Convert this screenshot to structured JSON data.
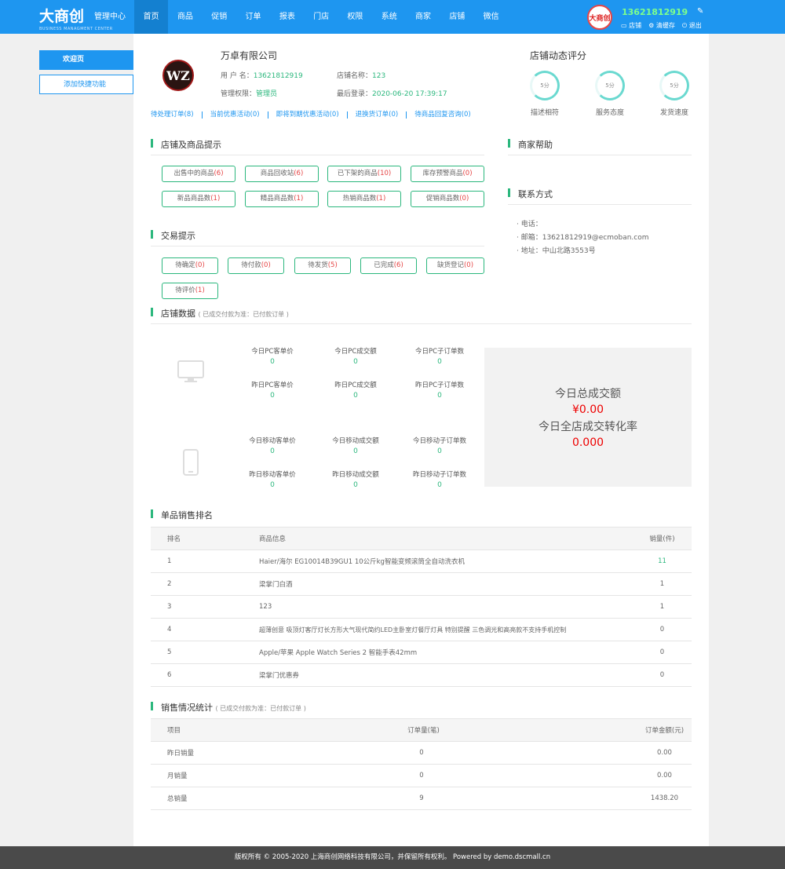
{
  "header": {
    "logo": "大商创",
    "subtitle": "管理中心",
    "logo_en": "BUSINESS MANAGMENT CENTER",
    "nav": [
      "首页",
      "商品",
      "促销",
      "订单",
      "报表",
      "门店",
      "权限",
      "系统",
      "商家",
      "店铺",
      "微信"
    ],
    "avatar_text": "大商创",
    "phone": "13621812919",
    "links": {
      "shop": "店铺",
      "clear_cache": "清缓存",
      "logout": "退出"
    }
  },
  "sidebar": {
    "items": [
      {
        "label": "欢迎页"
      },
      {
        "label": "添加快捷功能"
      }
    ]
  },
  "profile": {
    "logo_text": "WZ",
    "company": "万卓有限公司",
    "username_label": "用 户 名：",
    "username": "13621812919",
    "shopname_label": "店铺名称：",
    "shopname": "123",
    "role_label": "管理权限：",
    "role": "管理员",
    "lastlogin_label": "最后登录：",
    "lastlogin": "2020-06-20 17:39:17"
  },
  "quicklinks": [
    "待处理订单(8)",
    "当前优惠活动(0)",
    "即将到期优惠活动(0)",
    "退换货订单(0)",
    "待商品回复咨询(0)"
  ],
  "rating": {
    "title": "店铺动态评分",
    "items": [
      {
        "score": "5分",
        "label": "描述相符"
      },
      {
        "score": "5分",
        "label": "服务态度"
      },
      {
        "score": "5分",
        "label": "发货速度"
      }
    ]
  },
  "goods_tips": {
    "title": "店铺及商品提示",
    "buttons": [
      {
        "label": "出售中的商品",
        "count": "(6)"
      },
      {
        "label": "商品回收站",
        "count": "(6)"
      },
      {
        "label": "已下架的商品",
        "count": "(10)"
      },
      {
        "label": "库存预警商品",
        "count": "(0)"
      },
      {
        "label": "新品商品数",
        "count": "(1)"
      },
      {
        "label": "精品商品数",
        "count": "(1)"
      },
      {
        "label": "热销商品数",
        "count": "(1)"
      },
      {
        "label": "促销商品数",
        "count": "(0)"
      }
    ]
  },
  "trade_tips": {
    "title": "交易提示",
    "buttons": [
      {
        "label": "待确定",
        "count": "(0)"
      },
      {
        "label": "待付款",
        "count": "(0)"
      },
      {
        "label": "待发货",
        "count": "(5)"
      },
      {
        "label": "已完成",
        "count": "(6)"
      },
      {
        "label": "缺货登记",
        "count": "(0)"
      },
      {
        "label": "待评价",
        "count": "(1)"
      }
    ]
  },
  "help": {
    "title": "商家帮助"
  },
  "contact": {
    "title": "联系方式",
    "phone": "电话：",
    "email": "邮箱：13621812919@ecmoban.com",
    "address": "地址：中山北路3553号"
  },
  "shop_data": {
    "title": "店铺数据",
    "note": "( 已成交付款为准：已付款订单 )",
    "pc": [
      {
        "label": "今日PC客单价",
        "value": "0"
      },
      {
        "label": "今日PC成交额",
        "value": "0"
      },
      {
        "label": "今日PC子订单数",
        "value": "0"
      },
      {
        "label": "昨日PC客单价",
        "value": "0"
      },
      {
        "label": "昨日PC成交额",
        "value": "0"
      },
      {
        "label": "昨日PC子订单数",
        "value": "0"
      }
    ],
    "mobile": [
      {
        "label": "今日移动客单价",
        "value": "0"
      },
      {
        "label": "今日移动成交额",
        "value": "0"
      },
      {
        "label": "今日移动子订单数",
        "value": "0"
      },
      {
        "label": "昨日移动客单价",
        "value": "0"
      },
      {
        "label": "昨日移动成交额",
        "value": "0"
      },
      {
        "label": "昨日移动子订单数",
        "value": "0"
      }
    ],
    "total_label": "今日总成交额",
    "total_value": "¥0.00",
    "rate_label": "今日全店成交转化率",
    "rate_value": "0.000"
  },
  "ranking": {
    "title": "单品销售排名",
    "headers": [
      "排名",
      "商品信息",
      "销量(件)"
    ],
    "rows": [
      {
        "rank": "1",
        "name": "Haier/海尔 EG10014B39GU1 10公斤kg智能变频滚筒全自动洗衣机",
        "qty": "11"
      },
      {
        "rank": "2",
        "name": "梁掌门白酒",
        "qty": "1"
      },
      {
        "rank": "3",
        "name": "123",
        "qty": "1"
      },
      {
        "rank": "4",
        "name": "超薄创意 吸顶灯客厅灯长方形大气现代简约LED主卧室灯餐厅灯具 特别提醒 三色调光和高亮款不支持手机控制",
        "qty": "0"
      },
      {
        "rank": "5",
        "name": "Apple/苹果 Apple Watch Series 2 智能手表42mm",
        "qty": "0"
      },
      {
        "rank": "6",
        "name": "梁掌门优惠券",
        "qty": "0"
      }
    ]
  },
  "sales": {
    "title": "销售情况统计",
    "note": "( 已成交付款为准：已付款订单 )",
    "headers": [
      "项目",
      "订单量(笔)",
      "订单金额(元)"
    ],
    "rows": [
      {
        "item": "昨日销量",
        "orders": "0",
        "amount": "0.00"
      },
      {
        "item": "月销量",
        "orders": "0",
        "amount": "0.00"
      },
      {
        "item": "总销量",
        "orders": "9",
        "amount": "1438.20"
      }
    ]
  },
  "footer": {
    "text": "版权所有 © 2005-2020 上海商创网络科技有限公司，并保留所有权利。 Powered by demo.dscmall.cn"
  }
}
